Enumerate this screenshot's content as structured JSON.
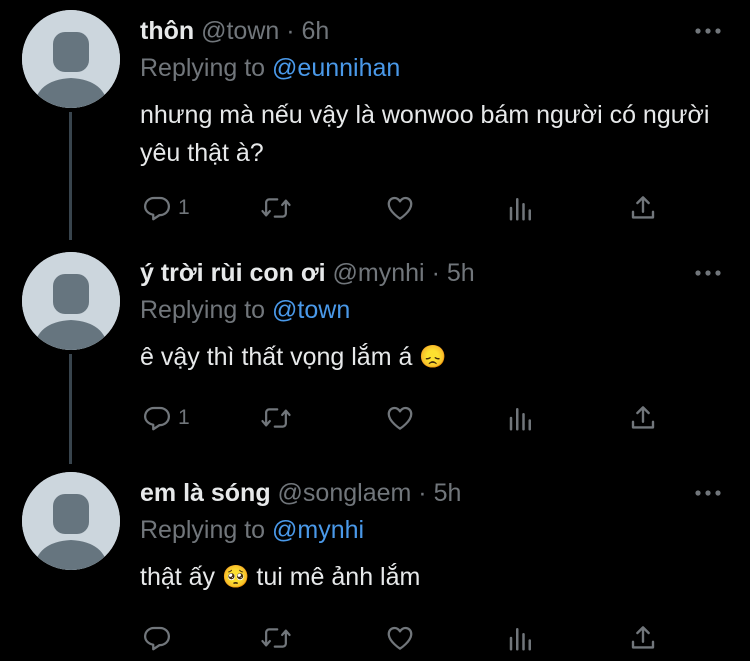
{
  "colors": {
    "background": "#000000",
    "primary_text": "#e7e9ea",
    "secondary_text": "#71767b",
    "link": "#4a99e9",
    "thread_line": "#38444d",
    "avatar_bg": "#ccd6dd",
    "avatar_fg": "#66757f"
  },
  "tweets": [
    {
      "display_name": "thôn",
      "handle": "@town",
      "separator": "·",
      "time": "6h",
      "replying_prefix": "Replying to",
      "replying_handle": "@eunnihan",
      "text": "nhưng mà nếu vậy là wonwoo bám người có người yêu thật à?",
      "reply_count": "1",
      "icons": [
        "reply-icon",
        "retweet-icon",
        "like-icon",
        "analytics-icon",
        "share-icon"
      ]
    },
    {
      "display_name": "ý trời rùi con ơi",
      "handle": "@mynhi",
      "separator": "·",
      "time": "5h",
      "replying_prefix": "Replying to",
      "replying_handle": "@town",
      "text": "ê vậy thì thất vọng lắm á",
      "emoji": "😞",
      "reply_count": "1",
      "icons": [
        "reply-icon",
        "retweet-icon",
        "like-icon",
        "analytics-icon",
        "share-icon"
      ]
    },
    {
      "display_name": "em là sóng",
      "handle": "@songlaem",
      "separator": "·",
      "time": "5h",
      "replying_prefix": "Replying to",
      "replying_handle": "@mynhi",
      "text_before": "thật ấy",
      "emoji": "🥺",
      "text_after": "tui mê ảnh lắm",
      "reply_count": "",
      "icons": [
        "reply-icon",
        "retweet-icon",
        "like-icon",
        "analytics-icon",
        "share-icon"
      ]
    }
  ]
}
